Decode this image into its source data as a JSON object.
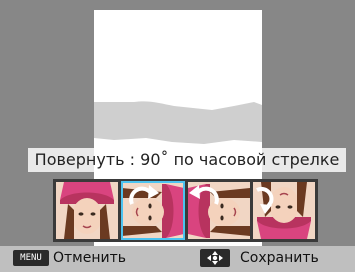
{
  "rotate_label": "Повернуть : 90˚ по часовой стрелке",
  "bottom_bar": {
    "menu_key": "MENU",
    "cancel_label": "Отменить",
    "save_label": "Сохранить"
  },
  "thumbnails": [
    {
      "state": "original",
      "arrow": "none"
    },
    {
      "state": "rotate-90-cw",
      "arrow": "clockwise",
      "selected": true
    },
    {
      "state": "rotate-90-ccw",
      "arrow": "counterclockwise"
    },
    {
      "state": "rotate-180",
      "arrow": "half-turn"
    }
  ],
  "colors": {
    "background": "#878787",
    "selection": "#4cc3f0",
    "hat_pink": "#d9447f"
  }
}
